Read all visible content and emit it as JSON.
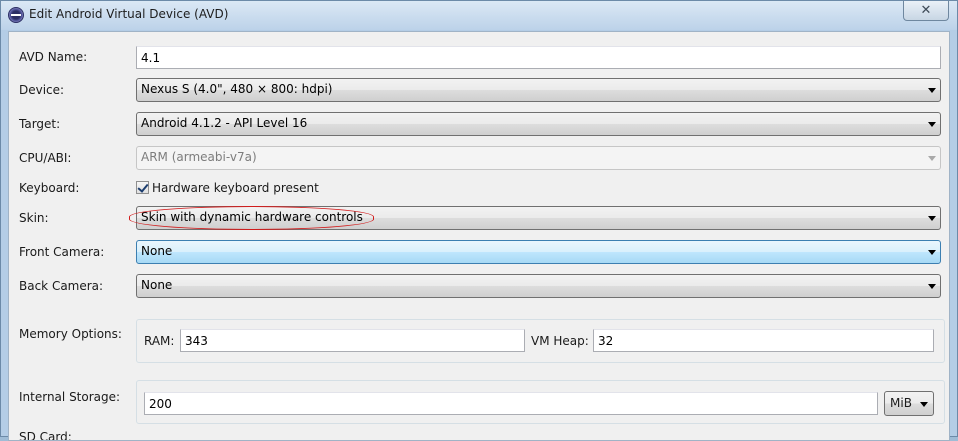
{
  "window": {
    "title": "Edit Android Virtual Device (AVD)",
    "close_label": "✕"
  },
  "form": {
    "avd_name": {
      "label": "AVD Name:",
      "value": "4.1"
    },
    "device": {
      "label": "Device:",
      "value": "Nexus S (4.0\", 480 × 800: hdpi)"
    },
    "target": {
      "label": "Target:",
      "value": "Android 4.1.2 - API Level 16"
    },
    "cpu_abi": {
      "label": "CPU/ABI:",
      "value": "ARM (armeabi-v7a)"
    },
    "keyboard": {
      "label": "Keyboard:",
      "checkbox_label": "Hardware keyboard present",
      "checked": true
    },
    "skin": {
      "label": "Skin:",
      "value": "Skin with dynamic hardware controls"
    },
    "front_camera": {
      "label": "Front Camera:",
      "value": "None"
    },
    "back_camera": {
      "label": "Back Camera:",
      "value": "None"
    },
    "memory": {
      "label": "Memory Options:",
      "ram_label": "RAM:",
      "ram_value": "343",
      "vm_heap_label": "VM Heap:",
      "vm_heap_value": "32"
    },
    "internal_storage": {
      "label": "Internal Storage:",
      "value": "200",
      "unit": "MiB"
    },
    "next_section_label": "SD Card:"
  },
  "colors": {
    "annotation_ellipse": "#d21b1b",
    "focus_border": "#3c7fb1"
  }
}
